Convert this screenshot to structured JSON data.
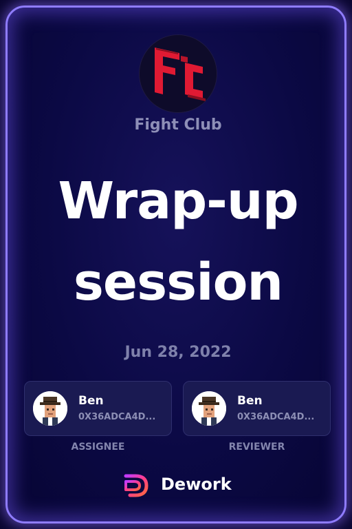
{
  "organization": {
    "name": "Fight Club",
    "logo_icon": "fight-club-logo"
  },
  "task": {
    "title_line1": "Wrap-up",
    "title_line2": "session",
    "date": "Jun 28, 2022"
  },
  "assignee": {
    "name": "Ben",
    "address": "0X36ADCA4D...",
    "role_label": "ASSIGNEE",
    "avatar_icon": "pixel-avatar"
  },
  "reviewer": {
    "name": "Ben",
    "address": "0X36ADCA4D...",
    "role_label": "REVIEWER",
    "avatar_icon": "pixel-avatar"
  },
  "brand": {
    "name": "Dework",
    "icon": "dework-logo-icon"
  },
  "colors": {
    "background": "#0b0944",
    "border_glow": "#8f7cff",
    "logo_red": "#e01a33",
    "muted_text": "#8e8fb7",
    "person_card": "#1a1a52"
  }
}
